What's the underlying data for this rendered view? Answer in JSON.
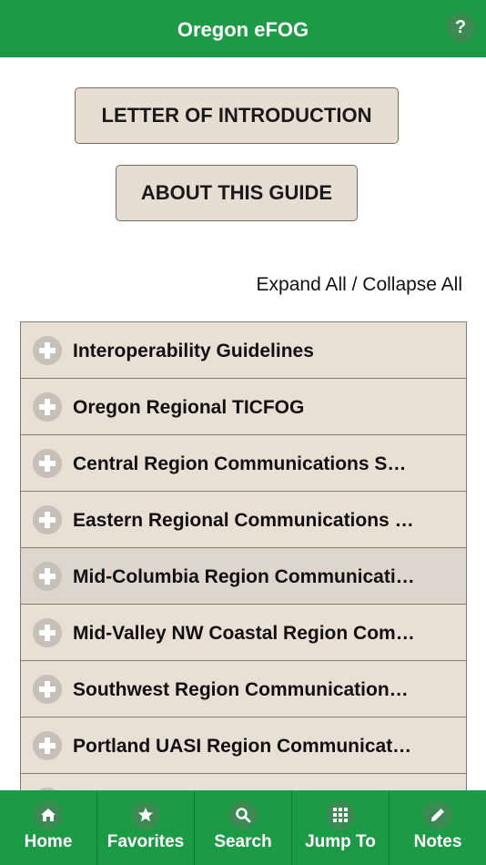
{
  "header": {
    "title": "Oregon eFOG",
    "help_label": "?"
  },
  "buttons": {
    "letter": "LETTER OF INTRODUCTION",
    "about": "ABOUT THIS GUIDE"
  },
  "expand_collapse": "Expand All / Collapse All",
  "list": {
    "items": [
      {
        "label": "Interoperability Guidelines"
      },
      {
        "label": "Oregon Regional TICFOG"
      },
      {
        "label": "Central Region Communications S…"
      },
      {
        "label": "Eastern Regional Communications …"
      },
      {
        "label": "Mid-Columbia Region Communicati…"
      },
      {
        "label": "Mid-Valley NW Coastal Region Com…"
      },
      {
        "label": "Southwest Region Communication…"
      },
      {
        "label": "Portland UASI Region Communicat…"
      },
      {
        "label": ""
      }
    ],
    "selected_index": 4
  },
  "tabbar": {
    "items": [
      {
        "label": "Home",
        "icon": "home-icon"
      },
      {
        "label": "Favorites",
        "icon": "star-icon"
      },
      {
        "label": "Search",
        "icon": "search-icon"
      },
      {
        "label": "Jump To",
        "icon": "grid-icon"
      },
      {
        "label": "Notes",
        "icon": "pencil-icon"
      }
    ]
  },
  "colors": {
    "accent_green": "#1d9a46",
    "button_bg": "#e6ddd3",
    "list_bg": "#e8dfd5",
    "selected_bg": "#dcd6cd"
  }
}
